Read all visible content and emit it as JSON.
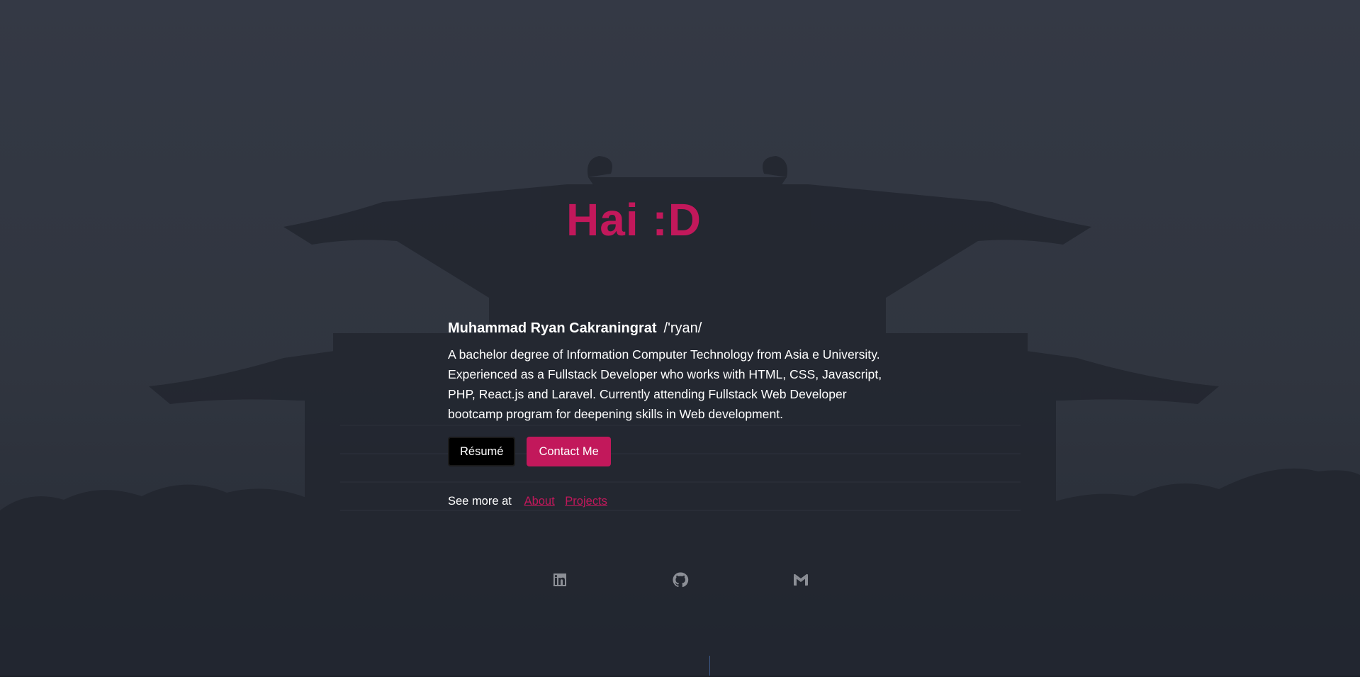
{
  "hero": {
    "headline": "Hai :D"
  },
  "intro": {
    "name": "Muhammad Ryan Cakraningrat",
    "pronunciation": "/'ryan/",
    "bio": "A bachelor degree of Information Computer Technology from Asia e University. Experienced as a Fullstack Developer who works with HTML, CSS, Javascript, PHP, React.js and Laravel. Currently attending Fullstack Web Developer bootcamp program for deepening skills in Web development."
  },
  "buttons": {
    "resume": "Résumé",
    "contact": "Contact Me"
  },
  "see_more": {
    "label": "See more at",
    "links": [
      "About",
      "Projects"
    ]
  },
  "socials": [
    {
      "icon": "linkedin-icon"
    },
    {
      "icon": "github-icon"
    },
    {
      "icon": "gmail-icon"
    }
  ],
  "colors": {
    "accent": "#c2185b",
    "background": "#323742",
    "resume_button": "#000000",
    "icon": "#8c8f96"
  }
}
